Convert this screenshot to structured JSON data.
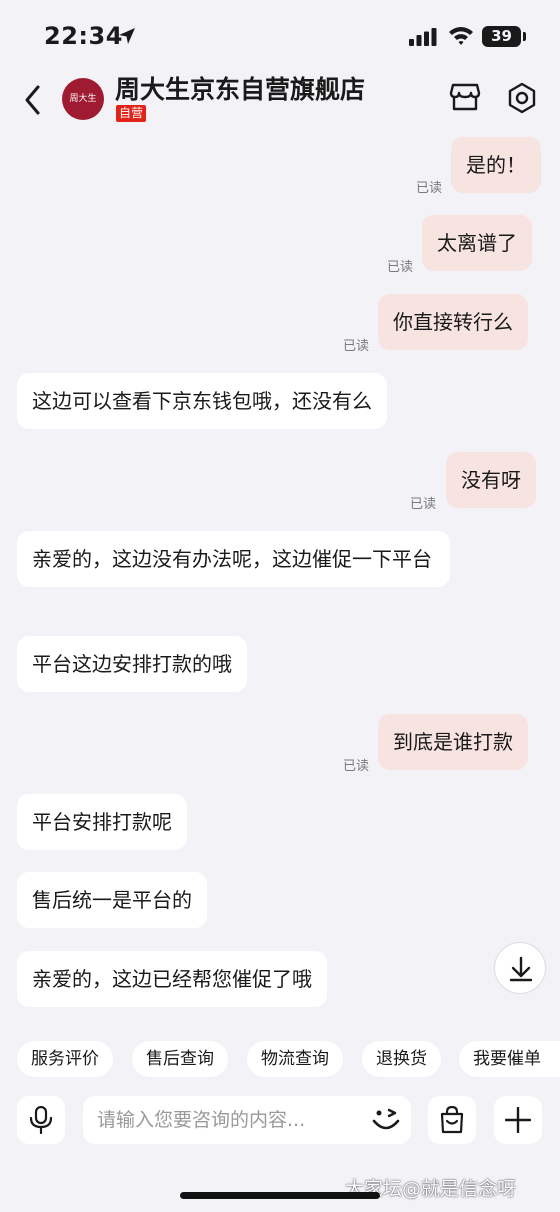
{
  "status_bar": {
    "time": "22:34",
    "battery": "39"
  },
  "header": {
    "shop_name": "周大生京东自营旗舰店",
    "self_tag": "自营",
    "logo_text": "周大生"
  },
  "colors": {
    "my_bubble": "#f7e3df",
    "their_bubble": "#ffffff",
    "self_tag": "#e2231a",
    "logo": "#9e1b32",
    "background": "#f2f2f7"
  },
  "messages": [
    {
      "from": "me",
      "text": "是的！",
      "read": "已读"
    },
    {
      "from": "me",
      "text": "太离谱了",
      "read": "已读"
    },
    {
      "from": "me",
      "text": "你直接转行么",
      "read": "已读"
    },
    {
      "from": "them",
      "text": "这边可以查看下京东钱包哦，还没有么"
    },
    {
      "from": "me",
      "text": "没有呀",
      "read": "已读"
    },
    {
      "from": "them",
      "text": "亲爱的，这边没有办法呢，这边催促一下平台"
    },
    {
      "from": "them",
      "text": "平台这边安排打款的哦"
    },
    {
      "from": "me",
      "text": "到底是谁打款",
      "read": "已读"
    },
    {
      "from": "them",
      "text": "平台安排打款呢"
    },
    {
      "from": "them",
      "text": "售后统一是平台的"
    },
    {
      "from": "them",
      "text": "亲爱的，这边已经帮您催促了哦"
    }
  ],
  "quick_actions": [
    "服务评价",
    "售后查询",
    "物流查询",
    "退换货",
    "我要催单"
  ],
  "input": {
    "placeholder": "请输入您要咨询的内容..."
  },
  "icons": {
    "back": "chevron-left-icon",
    "store": "store-icon",
    "settings": "hexagon-settings-icon",
    "scroll": "arrow-down-icon",
    "mic": "microphone-icon",
    "emoji": "wink-emoji-icon",
    "bag": "shopping-bag-icon",
    "plus": "plus-icon"
  },
  "watermark": "大家坛@就是信念呀"
}
